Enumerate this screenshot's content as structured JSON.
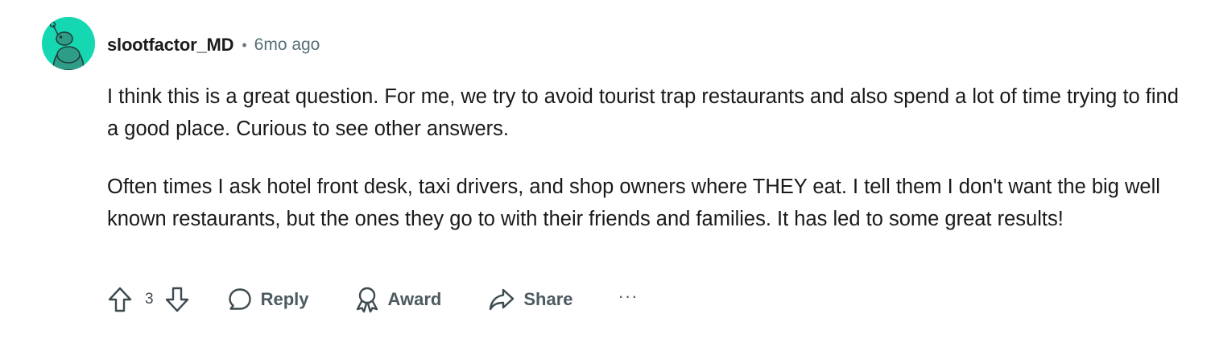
{
  "comment": {
    "author": "slootfactor_MD",
    "separator": "•",
    "timestamp": "6mo ago",
    "avatar": {
      "icon": "reddit-snoo-avatar-icon",
      "background_color": "#15d8b2"
    },
    "paragraphs": [
      "I think this is a great question. For me, we try to avoid tourist trap restaurants and also spend a lot of time trying to find a good place. Curious to see other answers.",
      "Often times I ask hotel front desk, taxi drivers, and shop owners where THEY eat. I tell them I don't want the big well known restaurants, but the ones they go to with their friends and families. It has led to some great results!"
    ]
  },
  "actions": {
    "upvote_icon": "upvote-arrow-icon",
    "vote_count": "3",
    "downvote_icon": "downvote-arrow-icon",
    "reply_label": "Reply",
    "reply_icon": "speech-bubble-icon",
    "award_label": "Award",
    "award_icon": "award-ribbon-icon",
    "share_label": "Share",
    "share_icon": "share-arrow-icon",
    "more_label": "···",
    "more_icon": "overflow-menu-icon"
  }
}
